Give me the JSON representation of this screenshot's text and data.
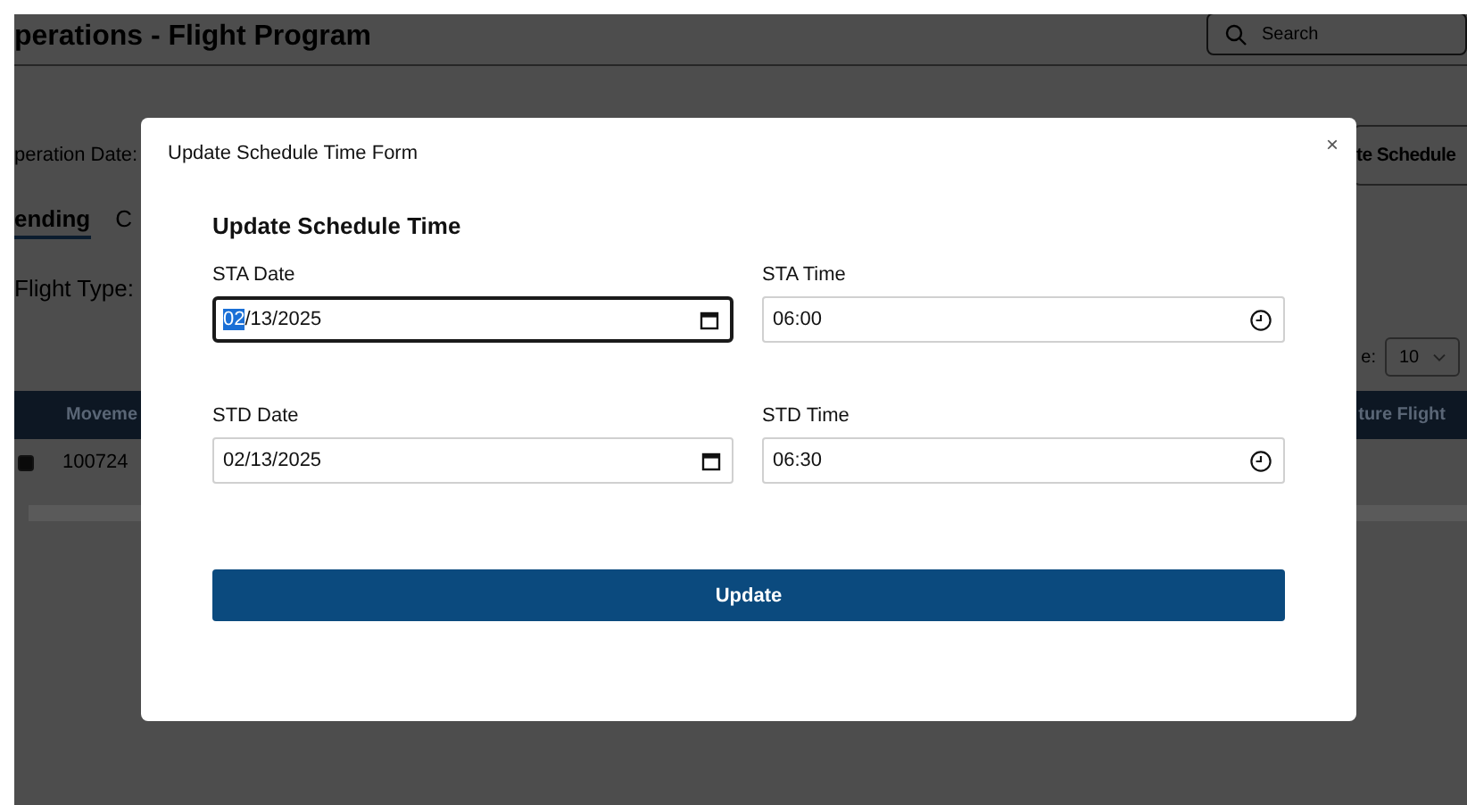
{
  "page": {
    "title": "perations - Flight Program",
    "search": {
      "placeholder": "Search"
    },
    "operation_date_label": "peration Date:",
    "schedule_button": "te Schedule",
    "tabs": [
      {
        "label": "ending",
        "selected": true
      },
      {
        "label": "C",
        "selected": false
      }
    ],
    "flight_type_label": "Flight Type:",
    "page_size": {
      "label": "e:",
      "value": "10"
    },
    "table": {
      "columns": [
        "Moveme",
        "ture Flight"
      ],
      "rows": [
        {
          "checked": true,
          "cells": [
            "100724"
          ]
        }
      ]
    }
  },
  "modal": {
    "title": "Update Schedule Time Form",
    "close": "×",
    "heading": "Update Schedule Time",
    "fields": [
      {
        "label": "STA Date",
        "kind": "date",
        "value": "02/13/2025",
        "focused": true
      },
      {
        "label": "STA Time",
        "kind": "time",
        "value": "06:00",
        "focused": false
      },
      {
        "label": "STD Date",
        "kind": "date",
        "value": "02/13/2025",
        "focused": false
      },
      {
        "label": "STD Time",
        "kind": "time",
        "value": "06:30",
        "focused": false
      }
    ],
    "button": "Update"
  }
}
